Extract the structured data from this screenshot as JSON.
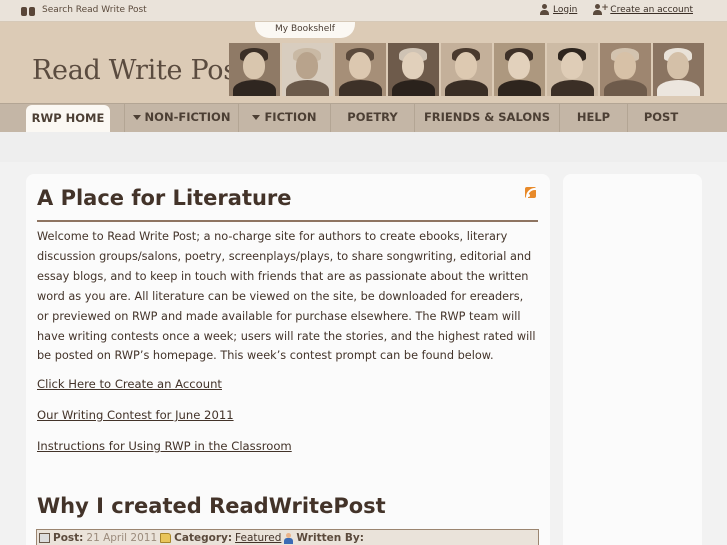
{
  "topbar": {
    "search_label": "Search Read Write Post",
    "login_label": "Login",
    "create_account_label": "Create an account"
  },
  "header": {
    "bookshelf_tab": "My Bookshelf",
    "site_title": "Read Write Post",
    "portrait_icons": [
      "portrait-1",
      "portrait-2",
      "portrait-3",
      "portrait-4",
      "portrait-5",
      "portrait-6",
      "portrait-7",
      "portrait-8",
      "portrait-9"
    ]
  },
  "nav": {
    "items": [
      {
        "label": "RWP HOME",
        "active": true,
        "dropdown": false
      },
      {
        "label": "NON-FICTION",
        "active": false,
        "dropdown": true
      },
      {
        "label": "FICTION",
        "active": false,
        "dropdown": true
      },
      {
        "label": "POETRY",
        "active": false,
        "dropdown": false
      },
      {
        "label": "FRIENDS & SALONS",
        "active": false,
        "dropdown": false
      },
      {
        "label": "HELP",
        "active": false,
        "dropdown": false
      },
      {
        "label": "POST",
        "active": false,
        "dropdown": false
      }
    ]
  },
  "main": {
    "heading": "A Place for Literature",
    "intro": "Welcome to Read Write Post; a no-charge site for authors to create ebooks, literary discussion groups/salons, poetry, screenplays/plays, to share songwriting, editorial and essay blogs, and to keep in touch with friends that are as passionate about the written word as you are. All literature can be viewed on the site, be downloaded for ereaders, or previewed on RWP and made available for purchase elsewhere. The RWP team will have writing contests once a week; users will rate the stories, and the highest rated will be posted on RWP’s homepage. This week’s contest prompt can be found below.",
    "links": [
      "Click Here to Create an Account",
      "Our Writing Contest for June 2011",
      "Instructions for Using RWP in the Classroom"
    ],
    "post": {
      "title": "Why I created ReadWritePost",
      "posted_label": "Post:",
      "posted_date": "21 April 2011",
      "category_label": "Category:",
      "category": "Featured",
      "written_by_label": "Written By:"
    }
  },
  "colors": {
    "header_bg": "#dccbb6",
    "nav_bg": "#c4b6a6",
    "text": "#433329",
    "rss": "#e88a2a"
  }
}
